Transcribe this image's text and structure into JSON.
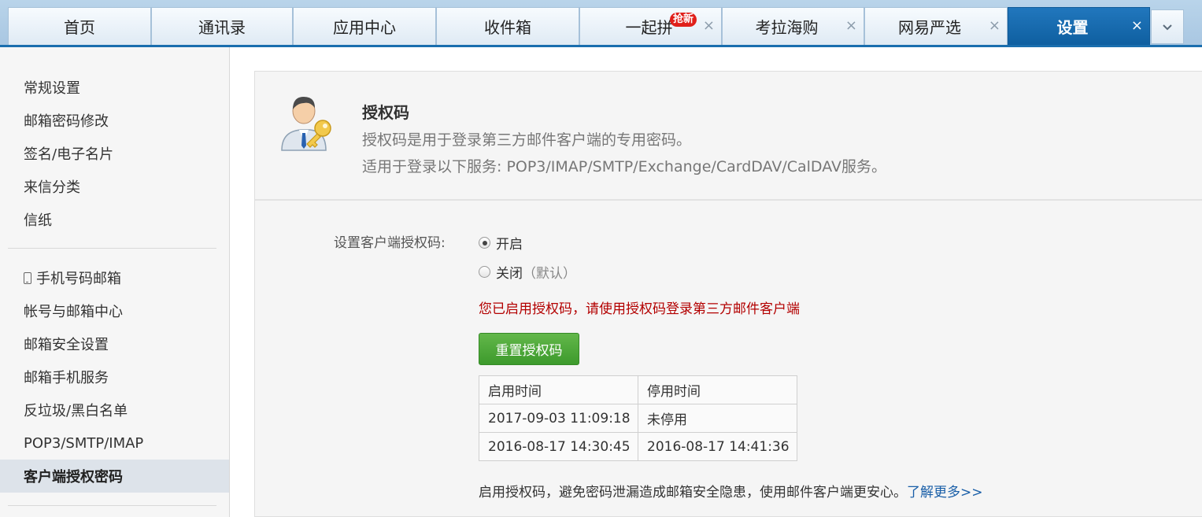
{
  "tabs": [
    {
      "label": "首页",
      "closable": false,
      "active": false
    },
    {
      "label": "通讯录",
      "closable": false,
      "active": false
    },
    {
      "label": "应用中心",
      "closable": false,
      "active": false
    },
    {
      "label": "收件箱",
      "closable": false,
      "active": false
    },
    {
      "label": "一起拼",
      "closable": true,
      "active": false,
      "badge": "抢新"
    },
    {
      "label": "考拉海购",
      "closable": true,
      "active": false
    },
    {
      "label": "网易严选",
      "closable": true,
      "active": false
    },
    {
      "label": "设置",
      "closable": true,
      "active": true
    }
  ],
  "tab_close_glyph": "×",
  "sidebar": {
    "group1": [
      "常规设置",
      "邮箱密码修改",
      "签名/电子名片",
      "来信分类",
      "信纸"
    ],
    "group2": [
      "手机号码邮箱",
      "帐号与邮箱中心",
      "邮箱安全设置",
      "邮箱手机服务",
      "反垃圾/黑白名单",
      "POP3/SMTP/IMAP",
      "客户端授权密码"
    ],
    "active": "客户端授权密码"
  },
  "header": {
    "title": "授权码",
    "desc1": "授权码是用于登录第三方邮件客户端的专用密码。",
    "desc2": "适用于登录以下服务: POP3/IMAP/SMTP/Exchange/CardDAV/CalDAV服务。"
  },
  "form": {
    "label": "设置客户端授权码:",
    "option_on": "开启",
    "option_off": "关闭",
    "option_off_note": "（默认）",
    "selected": "开启",
    "notice": "您已启用授权码，请使用授权码登录第三方邮件客户端",
    "reset_button": "重置授权码"
  },
  "table": {
    "headers": [
      "启用时间",
      "停用时间"
    ],
    "rows": [
      [
        "2017-09-03 11:09:18",
        "未停用"
      ],
      [
        "2016-08-17 14:30:45",
        "2016-08-17 14:41:36"
      ]
    ]
  },
  "footer": {
    "text": "启用授权码，避免密码泄漏造成邮箱安全隐患，使用邮件客户端更安心。",
    "link": "了解更多>>"
  },
  "colors": {
    "accent": "#1a6eae",
    "button": "#4aa636",
    "notice": "#b30000",
    "link": "#1a5fa8"
  }
}
